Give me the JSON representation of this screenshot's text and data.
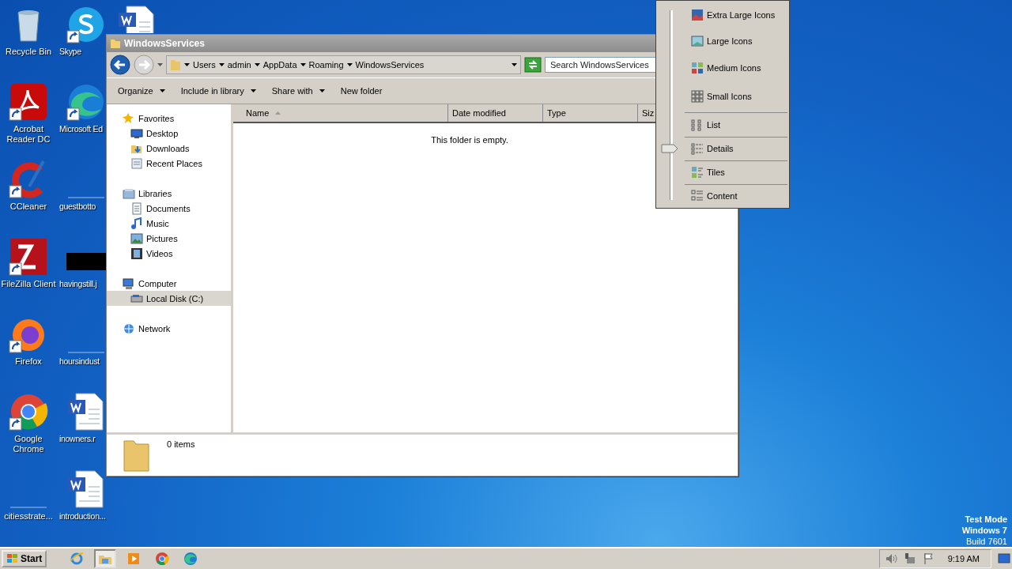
{
  "desktop": {
    "columns": [
      {
        "icons": [
          {
            "label": "Recycle Bin",
            "kind": "recycle",
            "shortcut": false
          },
          {
            "label": "Acrobat Reader DC",
            "kind": "acrobat",
            "shortcut": true
          },
          {
            "label": "CCleaner",
            "kind": "ccleaner",
            "shortcut": true
          },
          {
            "label": "FileZilla Client",
            "kind": "filezilla",
            "shortcut": true
          },
          {
            "label": "Firefox",
            "kind": "firefox",
            "shortcut": true
          },
          {
            "label": "Google Chrome",
            "kind": "chrome",
            "shortcut": true
          },
          {
            "label": "citiesstrate...",
            "kind": "blank",
            "shortcut": false
          }
        ]
      },
      {
        "icons": [
          {
            "label": "Skype",
            "kind": "skype",
            "shortcut": true
          },
          {
            "label": "Microsoft Ed",
            "kind": "edge",
            "shortcut": true
          },
          {
            "label": "guestbotto",
            "kind": "blank",
            "shortcut": false
          },
          {
            "label": "havingstill.j",
            "kind": "dark",
            "shortcut": false
          },
          {
            "label": "hoursindust",
            "kind": "blank",
            "shortcut": false
          },
          {
            "label": "inowners.r",
            "kind": "word",
            "shortcut": false
          },
          {
            "label": "introduction...",
            "kind": "word",
            "shortcut": false
          }
        ]
      },
      {
        "icons": [
          {
            "kind": "word",
            "shortcut": false
          }
        ]
      }
    ],
    "os_notice": [
      "Test Mode",
      "Windows 7",
      "Build 7601"
    ]
  },
  "window": {
    "title": "WindowsServices",
    "breadcrumb": [
      "Users",
      "admin",
      "AppData",
      "Roaming",
      "WindowsServices"
    ],
    "search": {
      "placeholder": "Search WindowsServices"
    },
    "toolbar": [
      {
        "label": "Organize",
        "dropdown": true
      },
      {
        "label": "Include in library",
        "dropdown": true
      },
      {
        "label": "Share with",
        "dropdown": true
      },
      {
        "label": "New folder",
        "dropdown": false
      }
    ],
    "nav": [
      {
        "label": "Favorites",
        "kind": "star",
        "selected": false,
        "children": [
          {
            "label": "Desktop",
            "kind": "desktop",
            "selected": false
          },
          {
            "label": "Downloads",
            "kind": "downloads",
            "selected": false
          },
          {
            "label": "Recent Places",
            "kind": "recent",
            "selected": false
          }
        ]
      },
      {
        "label": "Libraries",
        "kind": "library",
        "selected": false,
        "children": [
          {
            "label": "Documents",
            "kind": "documents",
            "selected": false
          },
          {
            "label": "Music",
            "kind": "music",
            "selected": false
          },
          {
            "label": "Pictures",
            "kind": "pictures",
            "selected": false
          },
          {
            "label": "Videos",
            "kind": "videos",
            "selected": false
          }
        ]
      },
      {
        "label": "Computer",
        "kind": "computer",
        "selected": false,
        "children": [
          {
            "label": "Local Disk (C:)",
            "kind": "disk",
            "selected": true
          }
        ]
      },
      {
        "label": "Network",
        "kind": "network",
        "selected": false
      }
    ],
    "columns": [
      {
        "label": "Name",
        "sorted": true
      },
      {
        "label": "Date modified",
        "sorted": false
      },
      {
        "label": "Type",
        "sorted": false
      },
      {
        "label": "Siz"
      }
    ],
    "empty_message": "This folder is empty.",
    "details": {
      "count": "0 items"
    }
  },
  "view_menu": {
    "items": [
      {
        "label": "Extra Large Icons",
        "kind": "xl",
        "selected": false,
        "separator": false
      },
      {
        "label": "Large Icons",
        "kind": "large",
        "selected": false,
        "separator": false
      },
      {
        "label": "Medium Icons",
        "kind": "medium",
        "selected": false,
        "separator": false
      },
      {
        "label": "Small Icons",
        "kind": "small",
        "selected": false,
        "separator": true
      },
      {
        "label": "List",
        "kind": "list",
        "selected": false,
        "separator": true
      },
      {
        "label": "Details",
        "kind": "details",
        "selected": true,
        "separator": true
      },
      {
        "label": "Tiles",
        "kind": "tiles",
        "selected": false,
        "separator": true
      },
      {
        "label": "Content",
        "kind": "content",
        "selected": false,
        "separator": false
      }
    ]
  },
  "taskbar": {
    "start": "Start",
    "apps": [
      {
        "kind": "ie",
        "selected": false
      },
      {
        "kind": "explorer",
        "selected": true
      },
      {
        "kind": "media",
        "selected": false
      },
      {
        "kind": "chrome",
        "selected": false
      },
      {
        "kind": "edge",
        "selected": false
      }
    ],
    "clock": "9:19 AM"
  }
}
